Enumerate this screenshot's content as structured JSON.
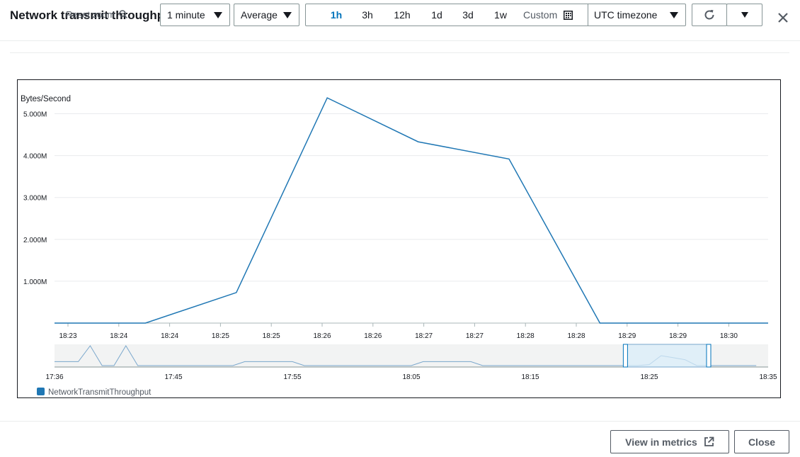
{
  "header": {
    "title": "Network transmit throughput",
    "reset_zoom": "Reset zoom",
    "period": "1 minute",
    "statistic": "Average",
    "time_ranges": [
      "1h",
      "3h",
      "12h",
      "1d",
      "3d",
      "1w"
    ],
    "active_range": "1h",
    "custom_label": "Custom",
    "timezone": "UTC timezone",
    "icons": {
      "refresh": "refresh-icon",
      "more": "caret-down-icon",
      "close": "close-icon",
      "calendar": "calendar-icon",
      "zoom": "zoom-icon"
    }
  },
  "chart_data": {
    "type": "line",
    "ylabel": "Bytes/Second",
    "y_tick_labels": [
      "1.000M",
      "2.000M",
      "3.000M",
      "4.000M",
      "5.000M"
    ],
    "y_ticks": [
      1000000,
      2000000,
      3000000,
      4000000,
      5000000
    ],
    "ylim": [
      0,
      5500000
    ],
    "x_tick_labels": [
      "18:23",
      "18:24",
      "18:24",
      "18:25",
      "18:25",
      "18:26",
      "18:26",
      "18:27",
      "18:27",
      "18:28",
      "18:28",
      "18:29",
      "18:29",
      "18:30"
    ],
    "x_range_minutes": [
      0,
      7.85
    ],
    "series": [
      {
        "name": "NetworkTransmitThroughput",
        "color": "#1f77b4",
        "x": [
          0,
          1,
          2,
          3,
          4,
          5,
          6,
          7,
          7.85
        ],
        "values": [
          0,
          0,
          730000,
          5380000,
          4330000,
          3920000,
          0,
          0,
          0
        ]
      }
    ],
    "overview": {
      "x_tick_labels": [
        "17:36",
        "17:45",
        "17:55",
        "18:05",
        "18:15",
        "18:25",
        "18:35"
      ],
      "x_tick_minutes": [
        0,
        10,
        20,
        30,
        40,
        50,
        60
      ],
      "x_range_minutes": [
        0,
        60
      ],
      "selection_minutes": [
        48,
        55
      ],
      "profile_x": [
        0,
        2,
        3,
        4,
        5,
        6,
        7,
        8,
        15,
        16,
        17,
        20,
        21,
        22,
        25,
        26,
        30,
        31,
        32,
        35,
        36,
        37,
        40,
        41,
        49,
        50,
        51,
        52,
        53,
        54,
        55,
        59
      ],
      "profile_y": [
        0.2,
        0.2,
        1,
        0,
        0,
        1,
        0,
        0,
        0,
        0.2,
        0.2,
        0.2,
        0,
        0,
        0,
        0,
        0,
        0.2,
        0.2,
        0.2,
        0,
        0,
        0,
        0,
        0,
        0.05,
        0.5,
        0.4,
        0.3,
        0,
        0,
        0
      ]
    },
    "legend": "bottom-left",
    "grid": true
  },
  "footer": {
    "view_in_metrics": "View in metrics",
    "close": "Close"
  }
}
